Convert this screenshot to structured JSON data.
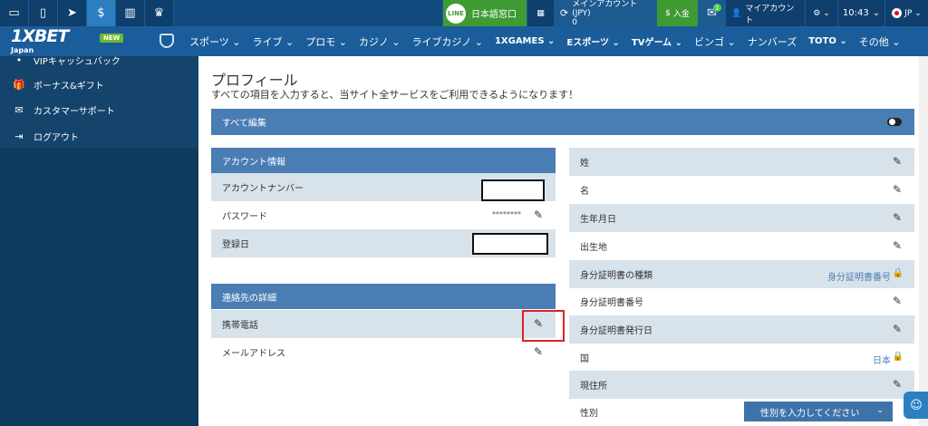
{
  "topbar": {
    "line_label": "日本語窓口",
    "line_icon_text": "LINE",
    "account_label": "メインアカウント(JPY)",
    "account_balance": "0",
    "deposit_label": "入金",
    "mail_badge": "1",
    "my_account": "マイアカウント",
    "clock": "10:43",
    "lang": "JP"
  },
  "brand": {
    "logo": "1XBET",
    "region": "Japan",
    "new_badge": "NEW"
  },
  "nav": [
    {
      "label": "スポーツ ⌄"
    },
    {
      "label": "ライブ ⌄"
    },
    {
      "label": "プロモ ⌄"
    },
    {
      "label": "カジノ ⌄"
    },
    {
      "label": "ライブカジノ ⌄"
    },
    {
      "label": "1XGAMES ⌄"
    },
    {
      "label": "Eスポーツ ⌄"
    },
    {
      "label": "TVゲーム ⌄"
    },
    {
      "label": "ビンゴ ⌄"
    },
    {
      "label": "ナンバーズ"
    },
    {
      "label": "TOTO ⌄"
    },
    {
      "label": "その他 ⌄"
    }
  ],
  "sidebar": {
    "partial_item": "VIPキャッシュバック",
    "items": [
      {
        "label": "ボーナス&ギフト"
      },
      {
        "label": "カスタマーサポート"
      },
      {
        "label": "ログアウト"
      }
    ]
  },
  "profile": {
    "title": "プロフィール",
    "subtitle": "すべての項目を入力すると、当サイト全サービスをご利用できるようになります！",
    "edit_all": "すべて編集",
    "account_section": "アカウント情報",
    "account_number": "アカウントナンバー",
    "password": "パスワード",
    "password_mask": "********",
    "reg_date": "登録日",
    "contact_section": "連絡先の詳細",
    "mobile": "携帯電話",
    "email": "メールアドレス"
  },
  "personal": {
    "last_name": "姓",
    "first_name": "名",
    "dob": "生年月日",
    "birthplace": "出生地",
    "id_type": "身分証明書の種類",
    "id_type_value": "身分証明書番号",
    "id_number": "身分証明書番号",
    "id_issue_date": "身分証明書発行日",
    "country": "国",
    "country_value": "日本",
    "address": "現住所",
    "gender": "性別",
    "gender_placeholder": "性別を入力してください"
  }
}
